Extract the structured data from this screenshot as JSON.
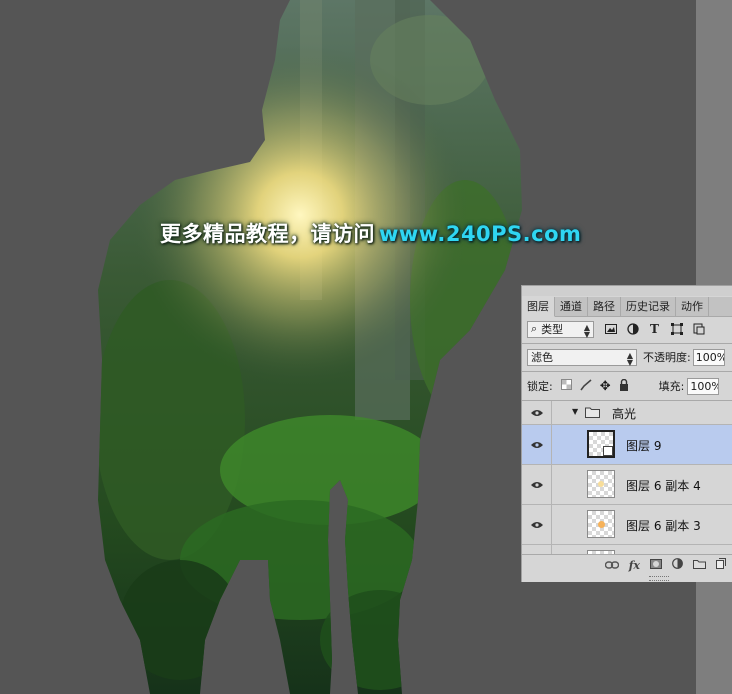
{
  "watermark": {
    "text_cn": "更多精品教程，请访问",
    "url": "www.240PS.com"
  },
  "layers_panel": {
    "tabs": [
      "图层",
      "通道",
      "路径",
      "历史记录",
      "动作"
    ],
    "active_tab": "图层",
    "filter": {
      "kind_label": "类型"
    },
    "blend_mode": "滤色",
    "opacity_label": "不透明度:",
    "opacity_value": "100%",
    "lock_label": "锁定:",
    "fill_label": "填充:",
    "fill_value": "100%",
    "group": {
      "name": "高光",
      "expanded": true
    },
    "layers": [
      {
        "name": "图层 9",
        "selected": true,
        "thumb_dot": ""
      },
      {
        "name": "图层 6 副本 4",
        "selected": false,
        "thumb_dot": "#f7dd9a"
      },
      {
        "name": "图层 6 副本 3",
        "selected": false,
        "thumb_dot": "#f6b25a"
      }
    ],
    "bottom_icons": [
      "link-icon",
      "fx-icon",
      "mask-icon",
      "adjustment-icon",
      "folder-icon",
      "new-layer-icon"
    ]
  },
  "colors": {
    "canvas_bg": "#555555",
    "selected_layer": "#b9cbee",
    "watermark_url": "#2fd6f2"
  }
}
